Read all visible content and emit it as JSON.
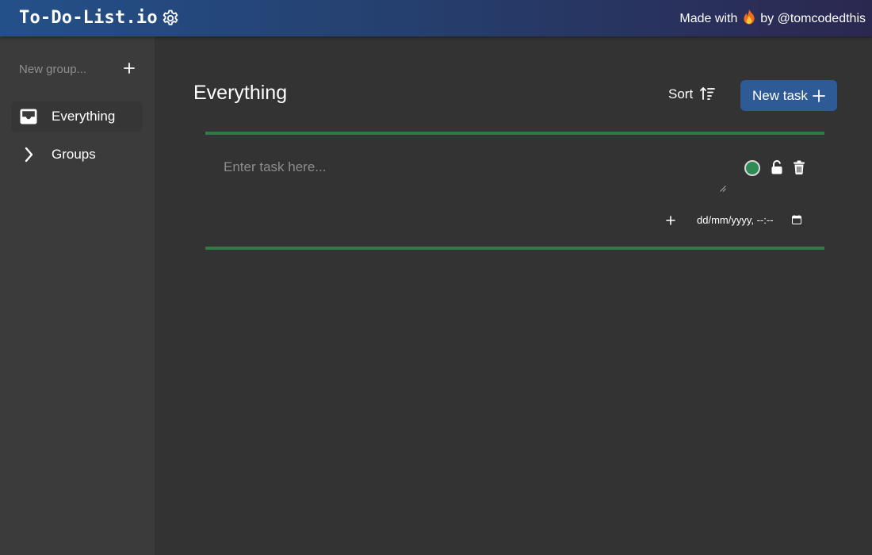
{
  "header": {
    "brand": "To-Do-List.io",
    "credit_prefix": "Made with",
    "credit_suffix": "by @tomcodedthis",
    "colors": {
      "gradient_start": "#245089",
      "gradient_end": "#2b2850"
    }
  },
  "sidebar": {
    "new_group_placeholder": "New group...",
    "items": [
      {
        "label": "Everything",
        "icon": "inbox-icon",
        "active": true
      },
      {
        "label": "Groups",
        "icon": "chevron-right-icon",
        "active": false
      }
    ]
  },
  "main": {
    "title": "Everything",
    "sort_label": "Sort",
    "new_task_label": "New task",
    "task": {
      "placeholder": "Enter task here...",
      "value": "",
      "date_placeholder": "dd/mm/yyyy, --:--",
      "status_color": "#2f8a55",
      "locked": false
    }
  },
  "colors": {
    "accent": "#2e5b95",
    "task_border": "#2e7a48",
    "background": "#333333",
    "sidebar": "#3b3b3c"
  }
}
